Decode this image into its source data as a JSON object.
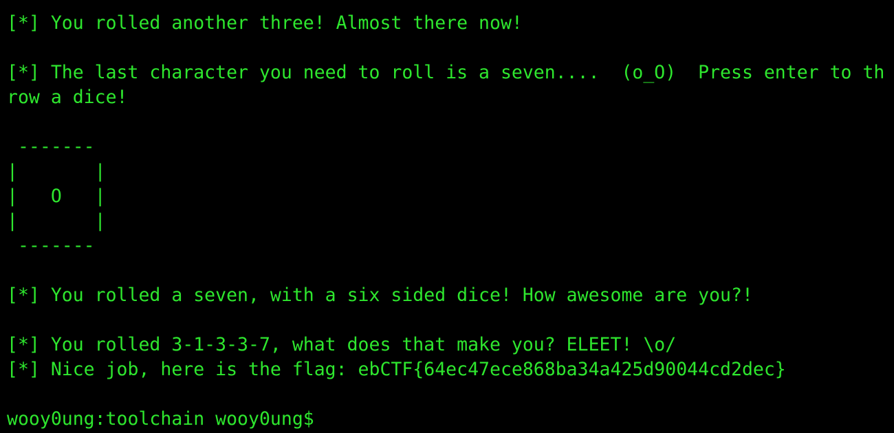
{
  "terminal": {
    "text_color": "#2ee62e",
    "background_color": "#000000",
    "lines": [
      "[*] You rolled another three! Almost there now!",
      "",
      "[*] The last character you need to roll is a seven....  (o_O)  Press enter to th",
      "row a dice!",
      "",
      " -------",
      "|       |",
      "|   O   |",
      "|       |",
      " -------",
      "",
      "[*] You rolled a seven, with a six sided dice! How awesome are you?!",
      "",
      "[*] You rolled 3-1-3-3-7, what does that make you? ELEET! \\o/",
      "[*] Nice job, here is the flag: ebCTF{64ec47ece868ba34a425d90044cd2dec}",
      ""
    ],
    "prompt": "wooy0ung:toolchain wooy0ung$"
  }
}
